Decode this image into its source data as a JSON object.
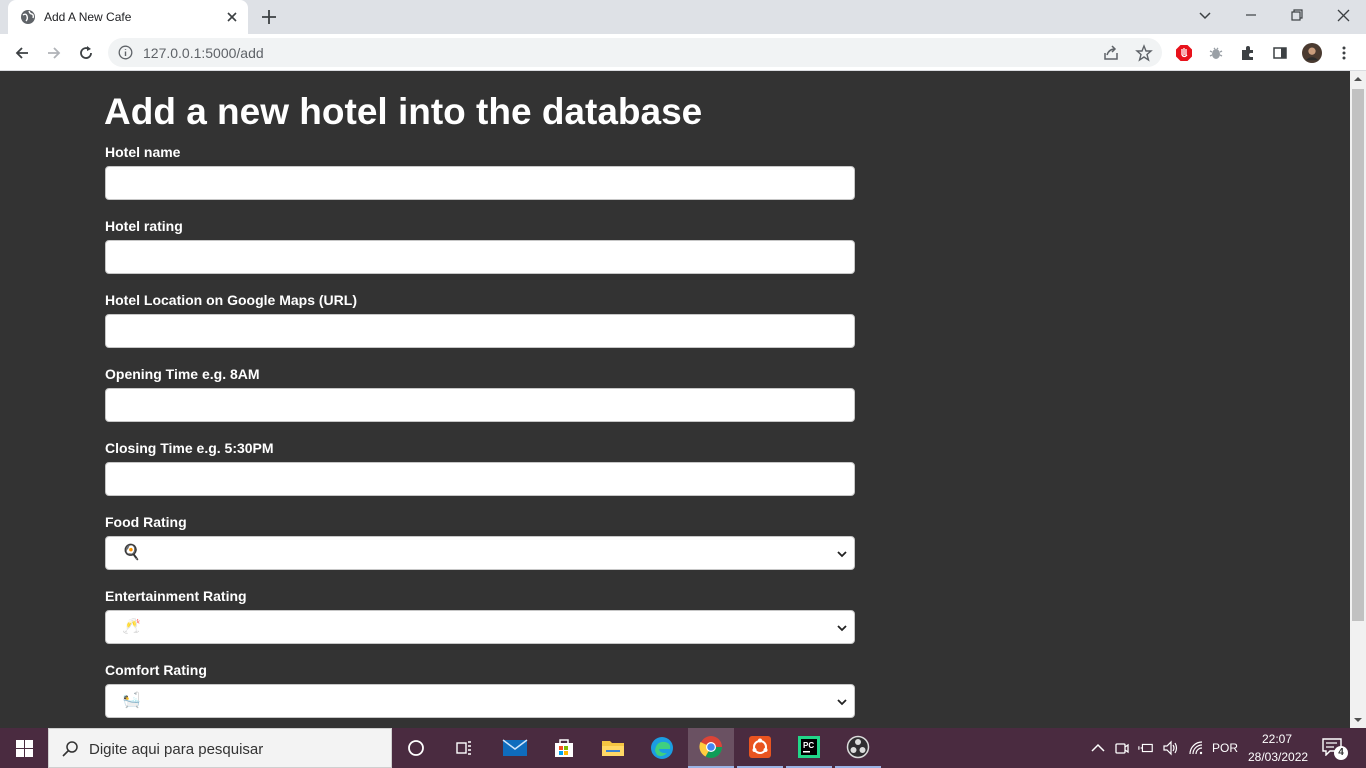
{
  "browser": {
    "tab_title": "Add A New Cafe",
    "url": "127.0.0.1:5000/add"
  },
  "page": {
    "title": "Add a new hotel into the database",
    "fields": [
      {
        "label": "Hotel name",
        "value": ""
      },
      {
        "label": "Hotel rating",
        "value": ""
      },
      {
        "label": "Hotel Location on Google Maps (URL)",
        "value": ""
      },
      {
        "label": "Opening Time e.g. 8AM",
        "value": ""
      },
      {
        "label": "Closing Time e.g. 5:30PM",
        "value": ""
      }
    ],
    "selects": [
      {
        "label": "Food Rating",
        "selected": "🍳"
      },
      {
        "label": "Entertainment Rating",
        "selected": "🥂"
      },
      {
        "label": "Comfort Rating",
        "selected": "🛀"
      }
    ]
  },
  "taskbar": {
    "search_placeholder": "Digite aqui para pesquisar",
    "language": "POR",
    "time": "22:07",
    "date": "28/03/2022",
    "notification_count": "4",
    "apps": [
      "cortana-icon",
      "task-view-icon",
      "mail-icon",
      "store-icon",
      "file-explorer-icon",
      "edge-icon",
      "chrome-icon",
      "ubuntu-icon",
      "pycharm-icon",
      "obs-icon"
    ]
  },
  "colors": {
    "page_background": "#333333",
    "taskbar": "#4a2b40",
    "tabstrip": "#dee1e6"
  }
}
